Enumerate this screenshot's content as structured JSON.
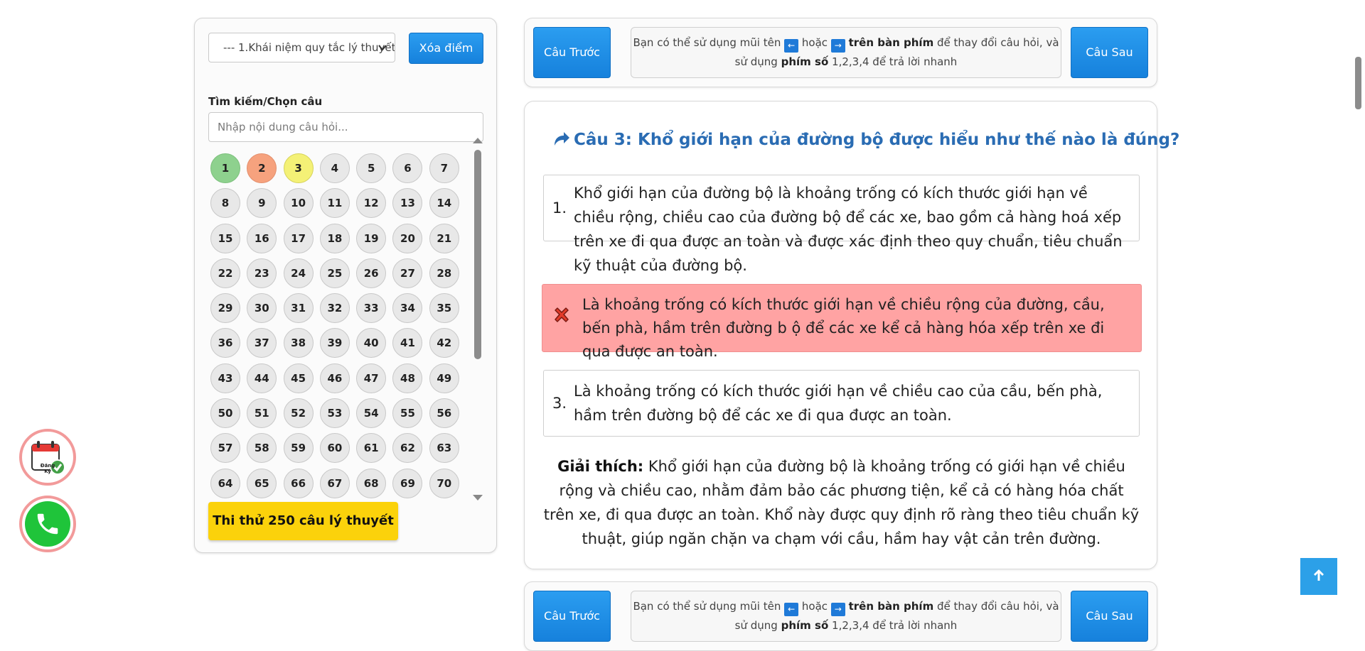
{
  "sidebar": {
    "topic_select_value": "--- 1.Khái niệm quy tắc lý thuyết",
    "clear_button": "Xóa điểm",
    "search_label": "Tìm kiếm/Chọn câu",
    "search_placeholder": "Nhập nội dung câu hỏi...",
    "question_numbers": [
      "1",
      "2",
      "3",
      "4",
      "5",
      "6",
      "7",
      "8",
      "9",
      "10",
      "11",
      "12",
      "13",
      "14",
      "15",
      "16",
      "17",
      "18",
      "19",
      "20",
      "21",
      "22",
      "23",
      "24",
      "25",
      "26",
      "27",
      "28",
      "29",
      "30",
      "31",
      "32",
      "33",
      "34",
      "35",
      "36",
      "37",
      "38",
      "39",
      "40",
      "41",
      "42",
      "43",
      "44",
      "45",
      "46",
      "47",
      "48",
      "49",
      "50",
      "51",
      "52",
      "53",
      "54",
      "55",
      "56",
      "57",
      "58",
      "59",
      "60",
      "61",
      "62",
      "63",
      "64",
      "65",
      "66",
      "67",
      "68",
      "69",
      "70"
    ],
    "question_status": {
      "1": "correct",
      "2": "wrong",
      "3": "current"
    },
    "test_button": "Thi thử 250 câu lý thuyết"
  },
  "nav": {
    "prev_label": "Câu Trước",
    "next_label": "Câu Sau",
    "hint_part1": "Bạn có thể sử dụng mũi tên",
    "key_left": "←",
    "hint_or": "hoặc",
    "key_right": "→",
    "hint_keyboard": "trên bàn phím",
    "hint_part2": "để thay đổi câu hỏi, và",
    "hint_part3": "sử dụng",
    "hint_numkeys": "phím số",
    "hint_part4": "1,2,3,4 để trả lời nhanh"
  },
  "question": {
    "title": "Câu 3: Khổ giới hạn của đường bộ được hiểu như thế nào là đúng?",
    "answers": [
      {
        "num": "1.",
        "text": "Khổ giới hạn của đường bộ là khoảng trống có kích thước giới hạn về chiều rộng, chiều cao của đường bộ để các xe, bao gồm cả hàng hoá xếp trên xe đi qua được an toàn và được xác định theo quy chuẩn, tiêu chuẩn kỹ thuật của đường bộ.",
        "state": "normal"
      },
      {
        "num": "2.",
        "text": "Là khoảng trống có kích thước giới hạn về chiều rộng của đường, cầu, bến phà, hầm trên đường b ộ để các xe kể cả hàng hóa xếp trên xe đi qua được an toàn.",
        "state": "wrong"
      },
      {
        "num": "3.",
        "text": "Là khoảng trống có kích thước giới hạn về chiều cao của cầu, bến phà, hầm trên đường bộ để các xe đi qua được an toàn.",
        "state": "normal"
      }
    ],
    "explain_label": "Giải thích:",
    "explain_text": "Khổ giới hạn của đường bộ là khoảng trống có giới hạn về chiều rộng và chiều cao, nhằm đảm bảo các phương tiện, kể cả có hàng hóa chất trên xe, đi qua được an toàn. Khổ này được quy định rõ ràng theo tiêu chuẩn kỹ thuật, giúp ngăn chặn va chạm với cầu, hầm hay vật cản trên đường."
  },
  "floating": {
    "register_label": "Đăng Ký"
  },
  "colors": {
    "primary_blue": "#1e88e5",
    "title_blue": "#2a6cb3",
    "wrong_bg": "#ffa3a3",
    "correct_circle": "#8ed18e",
    "wrong_circle": "#f6a27e",
    "current_circle": "#f4f176",
    "test_button": "#fbd20b"
  }
}
